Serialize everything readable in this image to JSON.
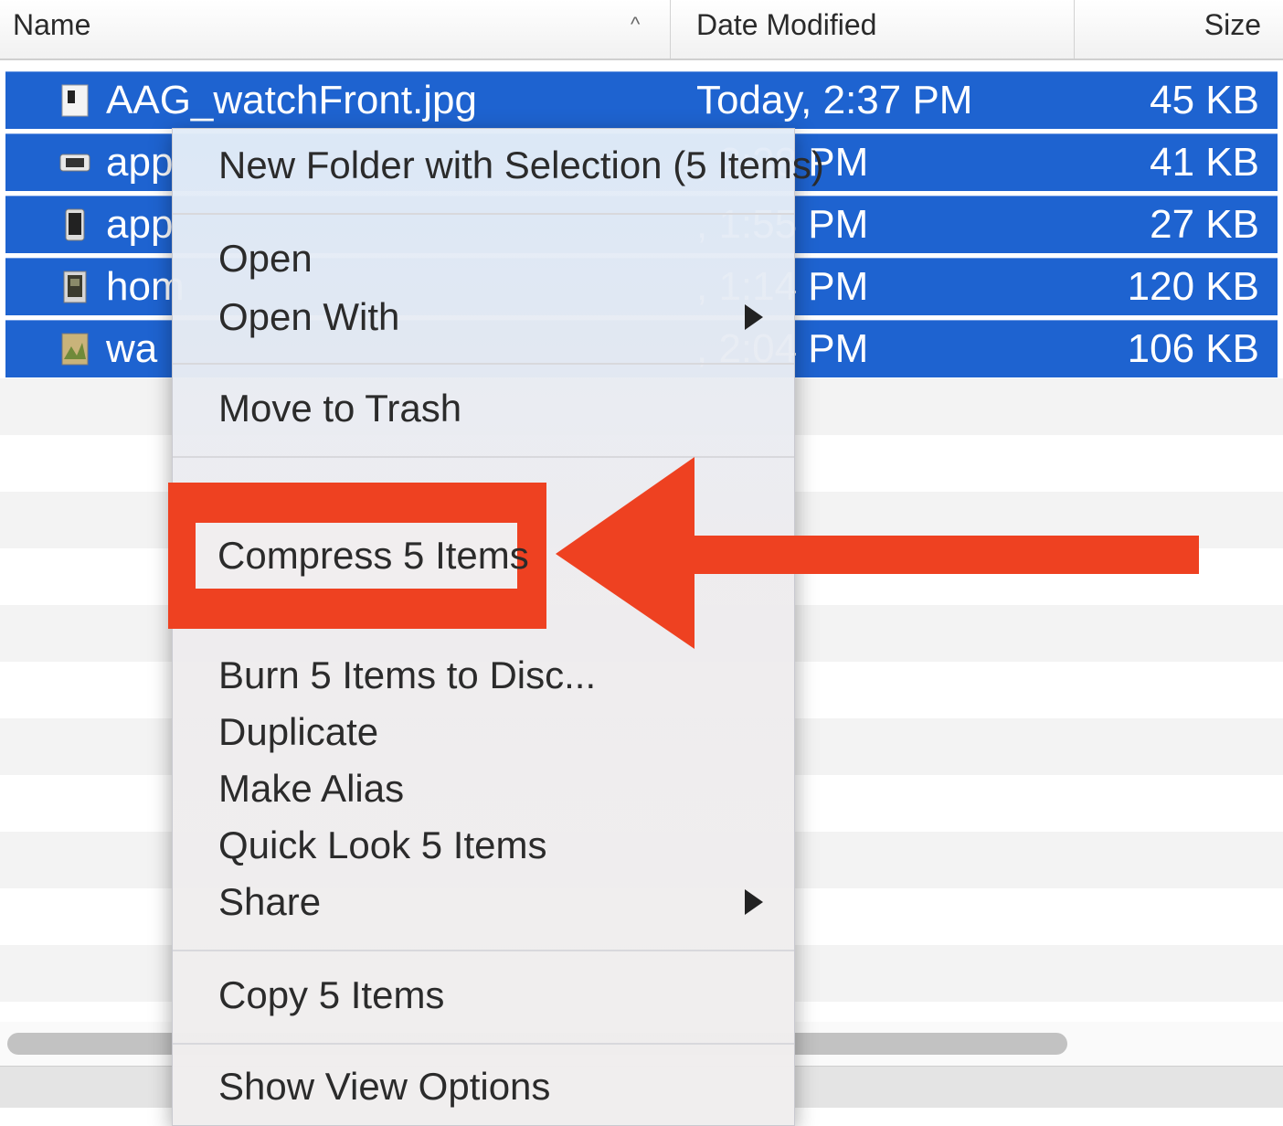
{
  "header": {
    "name_label": "Name",
    "sort_indicator": "^",
    "date_label": "Date Modified",
    "size_label": "Size"
  },
  "files": [
    {
      "name": "AAG_watchFront.jpg",
      "date": "Today, 2:37 PM",
      "size": "45 KB",
      "icon": "image-file-icon"
    },
    {
      "name": "app",
      "date": ", 2:38 PM",
      "size": "41 KB",
      "icon": "image-file-icon"
    },
    {
      "name": "app",
      "date": ", 1:55 PM",
      "size": "27 KB",
      "icon": "image-file-icon"
    },
    {
      "name": "hom",
      "date": ", 1:14 PM",
      "size": "120 KB",
      "icon": "image-file-icon"
    },
    {
      "name": "wa",
      "date": ", 2:04 PM",
      "size": "106 KB",
      "icon": "image-file-icon"
    }
  ],
  "context_menu": {
    "new_folder": "New Folder with Selection (5 Items)",
    "open": "Open",
    "open_with": "Open With",
    "move_to_trash": "Move to Trash",
    "compress": "Compress 5 Items",
    "burn": "Burn 5 Items to Disc...",
    "duplicate": "Duplicate",
    "make_alias": "Make Alias",
    "quick_look": "Quick Look 5 Items",
    "share": "Share",
    "copy": "Copy 5 Items",
    "show_view_options": "Show View Options"
  },
  "colors": {
    "selection": "#1e63d0",
    "annotation": "#ee4121"
  }
}
